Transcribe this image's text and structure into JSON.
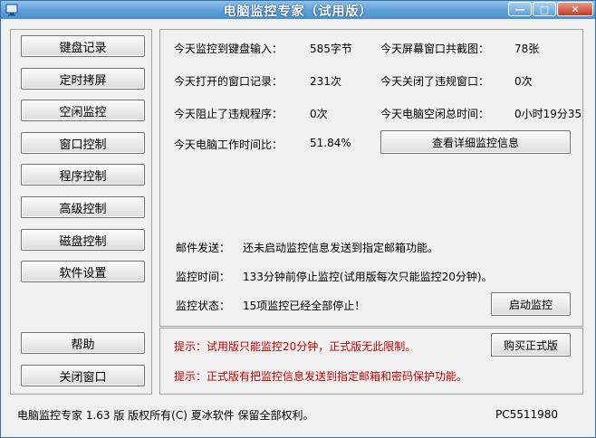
{
  "window": {
    "title": "电脑监控专家（试用版）"
  },
  "sidebar": {
    "items": [
      {
        "label": "键盘记录"
      },
      {
        "label": "定时拷屏"
      },
      {
        "label": "空闲监控"
      },
      {
        "label": "窗口控制"
      },
      {
        "label": "程序控制"
      },
      {
        "label": "高级控制"
      },
      {
        "label": "磁盘控制"
      },
      {
        "label": "软件设置"
      }
    ],
    "help_label": "帮助",
    "close_label": "关闭窗口"
  },
  "stats": {
    "keyboard_label": "今天监控到键盘输入：",
    "keyboard_value": "585字节",
    "screenshots_label": "今天屏幕窗口共截图：",
    "screenshots_value": "78张",
    "opened_windows_label": "今天打开的窗口记录：",
    "opened_windows_value": "231次",
    "closed_windows_label": "今天关闭了违规窗口：",
    "closed_windows_value": "0次",
    "blocked_programs_label": "今天阻止了违规程序：",
    "blocked_programs_value": "0次",
    "idle_time_label": "今天电脑空闲总时间：",
    "idle_time_value": "0小时19分35",
    "work_ratio_label": "今天电脑工作时间比：",
    "work_ratio_value": "51.84%",
    "details_button": "查看详细监控信息"
  },
  "status": {
    "mail_label": "邮件发送：",
    "mail_value": "还未启动监控信息发送到指定邮箱功能。",
    "time_label": "监控时间：",
    "time_value": "133分钟前停止监控(试用版每次只能监控20分钟)。",
    "state_label": "监控状态：",
    "state_value": "15项监控已经全部停止！",
    "start_button": "启动监控"
  },
  "notice": {
    "line1": "提示：试用版只能监控20分钟，正式版无此限制。",
    "line2": "提示：正式版有把监控信息发送到指定邮箱和密码保护功能。",
    "buy_button": "购买正式版"
  },
  "footer": {
    "copyright": "电脑监控专家  1.63 版  版权所有(C)  夏冰软件 保留全部权利。",
    "machine_id": "PC5511980"
  },
  "colors": {
    "title_bar": "#5f9fd8",
    "notice_text": "#c00000"
  }
}
